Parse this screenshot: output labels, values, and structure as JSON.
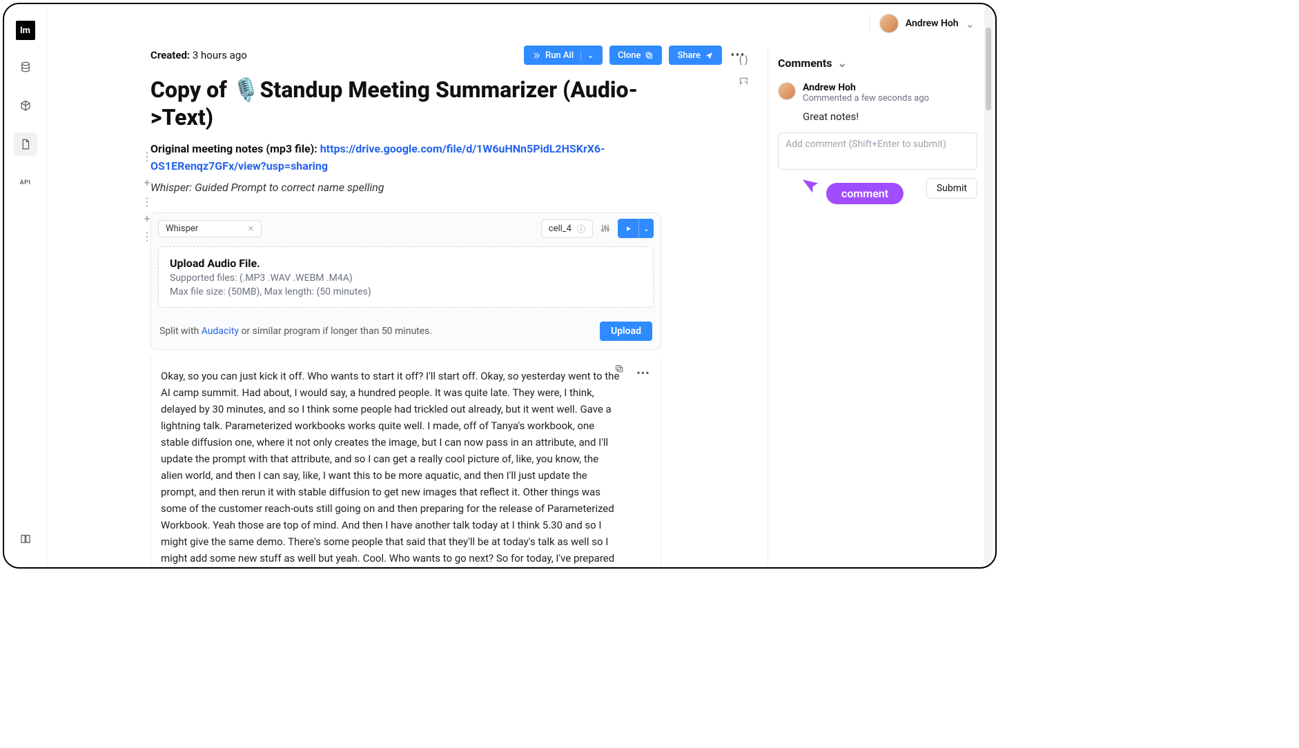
{
  "user": {
    "name": "Andrew Hoh"
  },
  "meta": {
    "created_label": "Created:",
    "created_value": "3 hours ago"
  },
  "buttons": {
    "run_all": "Run All",
    "clone": "Clone",
    "share": "Share",
    "upload": "Upload",
    "submit": "Submit"
  },
  "title_full": "Copy of 🎙️Standup Meeting Summarizer (Audio->Text)",
  "notes": {
    "prefix": "Original meeting notes (mp3 file): ",
    "link": "https://drive.google.com/file/d/1W6uHNn5PidL2HSKrX6-OS1ERenqz7GFx/view?usp=sharing"
  },
  "whisper_note": "Whisper: Guided Prompt to correct name spelling",
  "cell": {
    "tag": "Whisper",
    "id": "cell_4",
    "upload_title": "Upload Audio File.",
    "supported": "Supported files: (.MP3 .WAV .WEBM .M4A)",
    "limits": "Max file size: (50MB), Max length: (50 minutes)",
    "split_prefix": "Split with ",
    "split_link_text": "Audacity",
    "split_suffix": " or similar program if longer than 50 minutes."
  },
  "transcript": "Okay, so you can just kick it off. Who wants to start it off? I'll start off. Okay, so yesterday went to the AI camp summit. Had about, I would say, a hundred people. It was quite late. They were, I think, delayed by 30 minutes, and so I think some people had trickled out already, but it went well. Gave a lightning talk. Parameterized workbooks works quite well. I made, off of Tanya's workbook, one stable diffusion one, where it not only creates the image, but I can now pass in an attribute, and I'll update the prompt with that attribute, and so I can get a really cool picture of, like, you know, the alien world, and then I can say, like, I want this to be more aquatic, and then I'll just update the prompt, and then rerun it with stable diffusion to get new images that reflect it. Other things was some of the customer reach-outs still going on and then preparing for the release of Parameterized Workbook. Yeah those are top of mind. And then I have another talk today at I think 5.30 and so I might give the same demo. There's some people that said that they'll be at today's talk as well so I might add some new stuff as well but yeah. Cool. Who wants to go next? So for today, I've prepared the hero example to share and I'm going to work on the launch post and we should be done with the P0s, I guess, Brian? And we should be ready to go, but we'll sync all before we actually launch everything. And that's it. I'll pass it to you, Brian. Thanks. Yesterday, I was working on",
  "comments": {
    "heading": "Comments",
    "items": [
      {
        "author": "Andrew Hoh",
        "when": "Commented a few seconds ago",
        "text": "Great notes!"
      }
    ],
    "input_placeholder": "Add comment (Shift+Enter to submit)",
    "annotation": "comment"
  }
}
